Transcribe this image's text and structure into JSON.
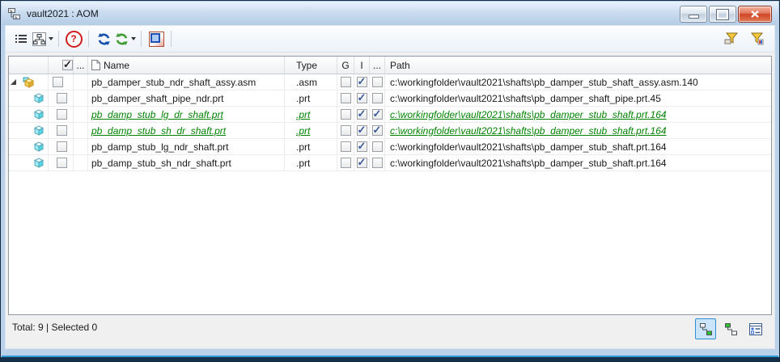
{
  "window": {
    "title": "vault2021 : AOM"
  },
  "titlebar": {
    "icons": [
      "app-hierarchy-icon"
    ],
    "controls": [
      "minimize",
      "maximize",
      "close"
    ]
  },
  "toolbar": {
    "buttons": [
      {
        "name": "list-view-button",
        "icon": "list-icon"
      },
      {
        "name": "hierarchy-view-button",
        "icon": "org-chart-icon",
        "has_dropdown": true
      },
      {
        "name": "help-button",
        "icon": "help-icon",
        "glyph": "?"
      },
      {
        "name": "refresh-button",
        "icon": "refresh-blue-icon"
      },
      {
        "name": "refresh-all-button",
        "icon": "refresh-green-icon",
        "has_dropdown": true
      },
      {
        "name": "open-in-window-button",
        "icon": "window-overlay-icon"
      }
    ],
    "right_buttons": [
      {
        "name": "filter-button",
        "icon": "filter-funnel-icon"
      },
      {
        "name": "filter-clear-button",
        "icon": "filter-funnel-badge-icon"
      }
    ]
  },
  "table": {
    "headers": {
      "select_all_checked": true,
      "dots1": "...",
      "name": "Name",
      "name_icon": "document-icon",
      "type": "Type",
      "g": "G",
      "i": "I",
      "dots2": "...",
      "path": "Path"
    },
    "rows": [
      {
        "level": 0,
        "expandable": true,
        "icon": "assembly",
        "selected": false,
        "name": "pb_damper_stub_ndr_shaft_assy.asm",
        "type": ".asm",
        "g": false,
        "i": true,
        "x": false,
        "path": "c:\\workingfolder\\vault2021\\shafts\\pb_damper_stub_shaft_assy.asm.140",
        "modified": false
      },
      {
        "level": 1,
        "expandable": false,
        "icon": "part",
        "selected": false,
        "name": "pb_damper_shaft_pipe_ndr.prt",
        "type": ".prt",
        "g": false,
        "i": true,
        "x": false,
        "path": "c:\\workingfolder\\vault2021\\shafts\\pb_damper_shaft_pipe.prt.45",
        "modified": false
      },
      {
        "level": 1,
        "expandable": false,
        "icon": "part",
        "selected": false,
        "name": "pb_damp_stub_lg_dr_shaft.prt",
        "type": ".prt",
        "g": false,
        "i": true,
        "x": true,
        "path": "c:\\workingfolder\\vault2021\\shafts\\pb_damper_stub_shaft.prt.164",
        "modified": true
      },
      {
        "level": 1,
        "expandable": false,
        "icon": "part",
        "selected": false,
        "name": "pb_damp_stub_sh_dr_shaft.prt",
        "type": ".prt",
        "g": false,
        "i": true,
        "x": true,
        "path": "c:\\workingfolder\\vault2021\\shafts\\pb_damper_stub_shaft.prt.164",
        "modified": true
      },
      {
        "level": 1,
        "expandable": false,
        "icon": "part",
        "selected": false,
        "name": "pb_damp_stub_lg_ndr_shaft.prt",
        "type": ".prt",
        "g": false,
        "i": true,
        "x": false,
        "path": "c:\\workingfolder\\vault2021\\shafts\\pb_damper_stub_shaft.prt.164",
        "modified": false
      },
      {
        "level": 1,
        "expandable": false,
        "icon": "part",
        "selected": false,
        "name": "pb_damp_stub_sh_ndr_shaft.prt",
        "type": ".prt",
        "g": false,
        "i": true,
        "x": false,
        "path": "c:\\workingfolder\\vault2021\\shafts\\pb_damper_stub_shaft.prt.164",
        "modified": false
      }
    ]
  },
  "statusbar": {
    "total": "Total: 9 | Selected 0",
    "view_buttons": [
      {
        "name": "hierarchy-view-toggle",
        "icon": "tree-view-icon",
        "active": true
      },
      {
        "name": "flat-view-toggle",
        "icon": "flat-tree-view-icon",
        "active": false
      },
      {
        "name": "details-view-toggle",
        "icon": "details-list-icon",
        "active": false
      }
    ]
  },
  "colors": {
    "modified_text": "#008200",
    "check_mark": "#39589c",
    "active_view_bg": "#cbe4f9",
    "active_view_border": "#2e8fd6",
    "close_button_red": "#cf4526",
    "title_gradient_top": "#eaf3fc"
  }
}
